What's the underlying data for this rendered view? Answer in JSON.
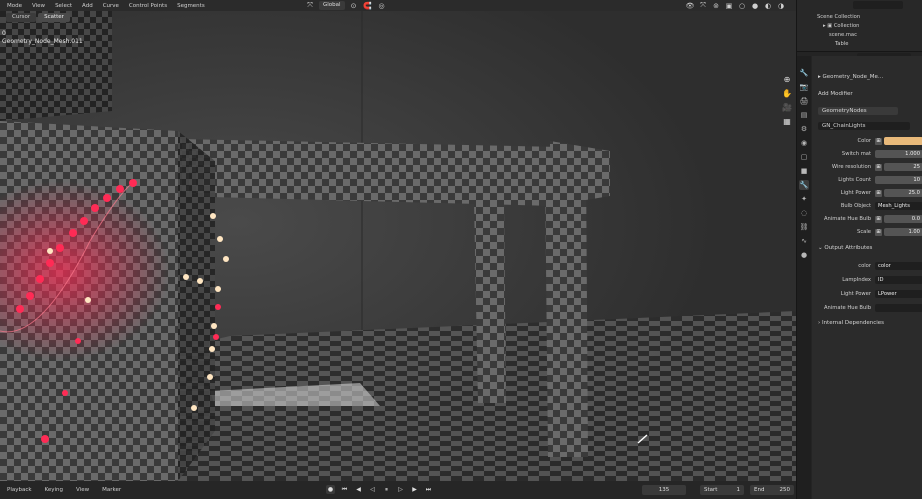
{
  "header": {
    "menus": [
      "Mode",
      "View",
      "Select",
      "Add",
      "Curve",
      "Control Points",
      "Segments"
    ],
    "transform_orientation": "Global"
  },
  "toolbar_tabs": [
    "Cursor",
    "Scatter"
  ],
  "viewport": {
    "object_name": "Geometry_Node_Mesh.011",
    "frame_label": "0"
  },
  "timeline": {
    "menus": [
      "Playback",
      "Keying",
      "View",
      "Marker"
    ],
    "current_frame": "135",
    "start_label": "Start",
    "start_value": "1",
    "end_label": "End",
    "end_value": "250"
  },
  "outliner": {
    "rows": [
      {
        "label": "Scene Collection"
      },
      {
        "label": "Collection"
      },
      {
        "label": "scene.mac"
      },
      {
        "label": "Table"
      }
    ]
  },
  "properties": {
    "add_modifier": "Add Modifier",
    "modifier_name": "GeometryNodes",
    "node_group": "GN_ChainLights",
    "fields": [
      {
        "label": "Color",
        "value": "",
        "kind": "color"
      },
      {
        "label": "Switch mat",
        "value": "1.000"
      },
      {
        "label": "Wire resolution",
        "value": "25"
      },
      {
        "label": "Lights Count",
        "value": "10"
      },
      {
        "label": "Light Power",
        "value": "25.0"
      },
      {
        "label": "Bulb Object",
        "value": "Mesh_Lights"
      },
      {
        "label": "Animate Hue Bulb",
        "value": "0.0"
      },
      {
        "label": "Scale",
        "value": "1.00"
      }
    ],
    "output_attributes_label": "Output Attributes",
    "outputs": [
      {
        "label": "color",
        "value": "color"
      },
      {
        "label": "LampIndex",
        "value": "ID"
      },
      {
        "label": "Light Power",
        "value": "LPower"
      },
      {
        "label": "Animate Hue Bulb",
        "value": ""
      }
    ],
    "internal_dependencies_label": "Internal Dependencies"
  },
  "colors": {
    "bulb_color": "#e8b97a",
    "lights_red": "#ff2b55",
    "lights_warm": "#ffe6c2"
  }
}
